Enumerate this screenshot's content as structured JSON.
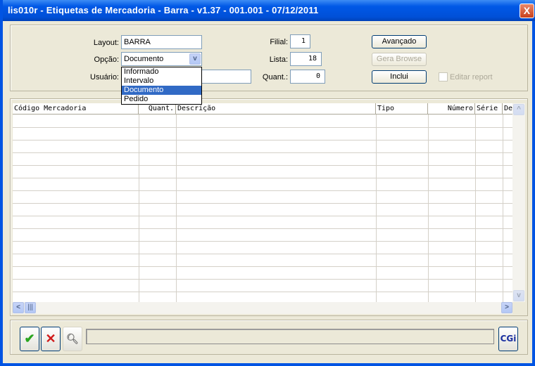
{
  "window": {
    "title": "lis010r - Etiquetas de Mercadoria - Barra - v1.37 - 001.001 - 07/12/2011",
    "close": "X"
  },
  "form": {
    "layout_label": "Layout:",
    "layout_value": "BARRA",
    "opcao_label": "Opção:",
    "opcao_value": "Documento",
    "opcao_options": [
      "Informado",
      "Intervalo",
      "Documento",
      "Pedido"
    ],
    "usuario_label": "Usuário:",
    "usuario_value": "",
    "filial_label": "Filial:",
    "filial_value": "1",
    "lista_label": "Lista:",
    "lista_value": "18",
    "quant_label": "Quant.:",
    "quant_value": "0",
    "avancado": "Avançado",
    "gera_browse": "Gera Browse",
    "inclui": "Inclui",
    "editar_report": "Editar report",
    "editar_report_checked": false
  },
  "grid": {
    "columns": [
      "Código Mercadoria",
      "Quant.",
      "Descrição",
      "Tipo",
      "Número",
      "Série",
      "De"
    ],
    "rows": []
  },
  "footer": {
    "status": "",
    "logo": "CGi",
    "confirm_icon": "check-icon",
    "cancel_icon": "x-icon",
    "search_icon": "magnifier-icon"
  }
}
